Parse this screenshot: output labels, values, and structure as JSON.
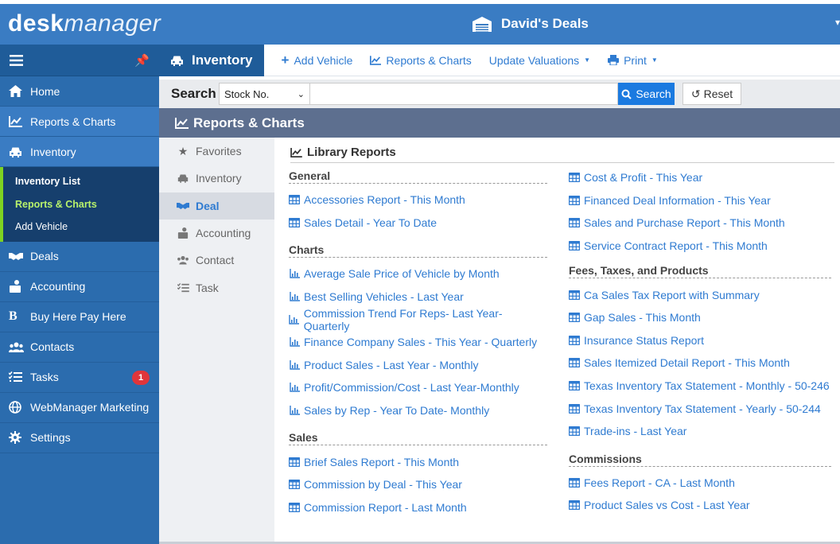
{
  "app": {
    "brand_bold": "desk",
    "brand_italic": "manager",
    "dealer_name": "David's Deals"
  },
  "sidebar": {
    "items": [
      {
        "label": "Home",
        "icon": "home-icon"
      },
      {
        "label": "Reports & Charts",
        "icon": "chart-icon"
      },
      {
        "label": "Inventory",
        "icon": "car-icon"
      }
    ],
    "sub": [
      "Inventory List",
      "Reports & Charts",
      "Add Vehicle"
    ],
    "items2": [
      {
        "label": "Deals",
        "icon": "handshake-icon"
      },
      {
        "label": "Accounting",
        "icon": "accounting-icon"
      },
      {
        "label": "Buy Here Pay Here",
        "icon": "bhph-icon"
      },
      {
        "label": "Contacts",
        "icon": "contacts-icon"
      },
      {
        "label": "Tasks",
        "icon": "tasks-icon",
        "badge": "1"
      },
      {
        "label": "WebManager Marketing",
        "icon": "globe-icon"
      },
      {
        "label": "Settings",
        "icon": "gear-icon"
      }
    ]
  },
  "toolbar": {
    "title": "Inventory",
    "add_vehicle": "Add Vehicle",
    "reports_charts": "Reports & Charts",
    "update_valuations": "Update Valuations",
    "print": "Print"
  },
  "search": {
    "label": "Search",
    "field_selected": "Stock No.",
    "value": "",
    "search_button": "Search",
    "reset_button": "Reset"
  },
  "section": {
    "title": "Reports & Charts",
    "library_title": "Library Reports"
  },
  "categories": [
    "Favorites",
    "Inventory",
    "Deal",
    "Accounting",
    "Contact",
    "Task"
  ],
  "left_groups": [
    {
      "title": "General",
      "reports": [
        {
          "label": "Accessories Report - This Month",
          "icon": "table"
        },
        {
          "label": "Sales Detail - Year To Date",
          "icon": "table"
        }
      ]
    },
    {
      "title": "Charts",
      "reports": [
        {
          "label": "Average Sale Price of Vehicle by Month",
          "icon": "chart"
        },
        {
          "label": "Best Selling Vehicles - Last Year",
          "icon": "chart"
        },
        {
          "label": "Commission Trend For Reps- Last Year- Quarterly",
          "icon": "chart"
        },
        {
          "label": "Finance Company Sales - This Year - Quarterly",
          "icon": "chart"
        },
        {
          "label": "Product Sales - Last Year - Monthly",
          "icon": "chart"
        },
        {
          "label": "Profit/Commission/Cost - Last Year-Monthly",
          "icon": "chart"
        },
        {
          "label": "Sales by Rep - Year To Date- Monthly",
          "icon": "chart"
        }
      ]
    },
    {
      "title": "Sales",
      "reports": [
        {
          "label": "Brief Sales Report - This Month",
          "icon": "table"
        },
        {
          "label": "Commission by Deal - This Year",
          "icon": "table"
        },
        {
          "label": "Commission Report - Last Month",
          "icon": "table"
        }
      ]
    }
  ],
  "right_top_reports": [
    {
      "label": "Cost & Profit - This Year",
      "icon": "table"
    },
    {
      "label": "Financed Deal Information - This Year",
      "icon": "table"
    },
    {
      "label": "Sales and Purchase Report - This Month",
      "icon": "table"
    },
    {
      "label": "Service Contract Report - This Month",
      "icon": "table"
    }
  ],
  "right_groups": [
    {
      "title": "Fees, Taxes, and Products",
      "reports": [
        {
          "label": "Ca Sales Tax Report with Summary",
          "icon": "table"
        },
        {
          "label": "Gap Sales - This Month",
          "icon": "table"
        },
        {
          "label": "Insurance Status Report",
          "icon": "table"
        },
        {
          "label": "Sales Itemized Detail Report - This Month",
          "icon": "table"
        },
        {
          "label": "Texas Inventory Tax Statement - Monthly - 50-246",
          "icon": "table"
        },
        {
          "label": "Texas Inventory Tax Statement - Yearly - 50-244",
          "icon": "table"
        },
        {
          "label": "Trade-ins - Last Year",
          "icon": "table"
        }
      ]
    },
    {
      "title": "Commissions",
      "reports": [
        {
          "label": "Fees Report - CA - Last Month",
          "icon": "table"
        },
        {
          "label": "Product Sales vs Cost - Last Year",
          "icon": "table"
        }
      ]
    }
  ],
  "colors": {
    "primary": "#3a7cc3",
    "dark": "#1f5c99",
    "link": "#2f7bd1",
    "accent": "#7ed321",
    "badge": "#e0353b",
    "section": "#5d6f8f"
  }
}
